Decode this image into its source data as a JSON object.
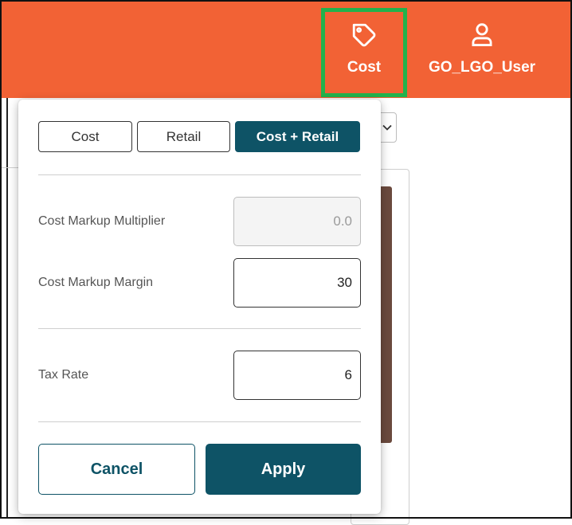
{
  "header": {
    "cost_nav_label": "Cost",
    "user_nav_label": "GO_LGO_User",
    "background_color": "#F26235",
    "highlight_color": "#22B24C",
    "cost_icon": "tag-icon",
    "user_icon": "user-icon"
  },
  "price_view": {
    "options": [
      "Cost",
      "Retail",
      "Cost + Retail"
    ],
    "selected": "Cost + Retail"
  },
  "fields": {
    "cost_markup_multiplier": {
      "label": "Cost Markup Multiplier",
      "value": "0.0",
      "disabled": true
    },
    "cost_markup_margin": {
      "label": "Cost Markup Margin",
      "value": "30"
    },
    "tax_rate": {
      "label": "Tax Rate",
      "value": "6"
    }
  },
  "actions": {
    "cancel_label": "Cancel",
    "apply_label": "Apply"
  },
  "colors": {
    "primary": "#0E5366"
  }
}
